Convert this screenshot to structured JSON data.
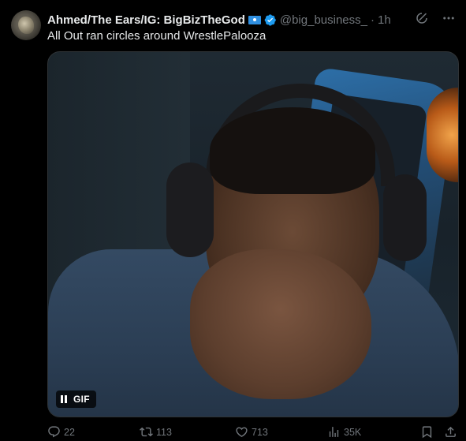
{
  "tweet": {
    "display_name": "Ahmed/The Ears/IG: BigBizTheGod",
    "handle": "@big_business_",
    "separator": "·",
    "time": "1h",
    "text": "All Out ran circles around WrestlePalooza"
  },
  "media": {
    "gif_label": "GIF"
  },
  "actions": {
    "replies": "22",
    "reposts": "113",
    "likes": "713",
    "views": "35K"
  },
  "colors": {
    "background": "#000000",
    "text_primary": "#e7e9ea",
    "text_secondary": "#71767b",
    "verified_blue": "#1d9bf0",
    "border": "#2f3336"
  },
  "icons": {
    "avatar": "profile-avatar",
    "verified": "verified-badge-icon",
    "flag": "flag-icon",
    "grok": "grok-icon",
    "more": "more-icon",
    "pause": "pause-icon",
    "reply": "reply-icon",
    "repost": "repost-icon",
    "like": "heart-icon",
    "views": "views-icon",
    "bookmark": "bookmark-icon",
    "share": "share-icon"
  }
}
